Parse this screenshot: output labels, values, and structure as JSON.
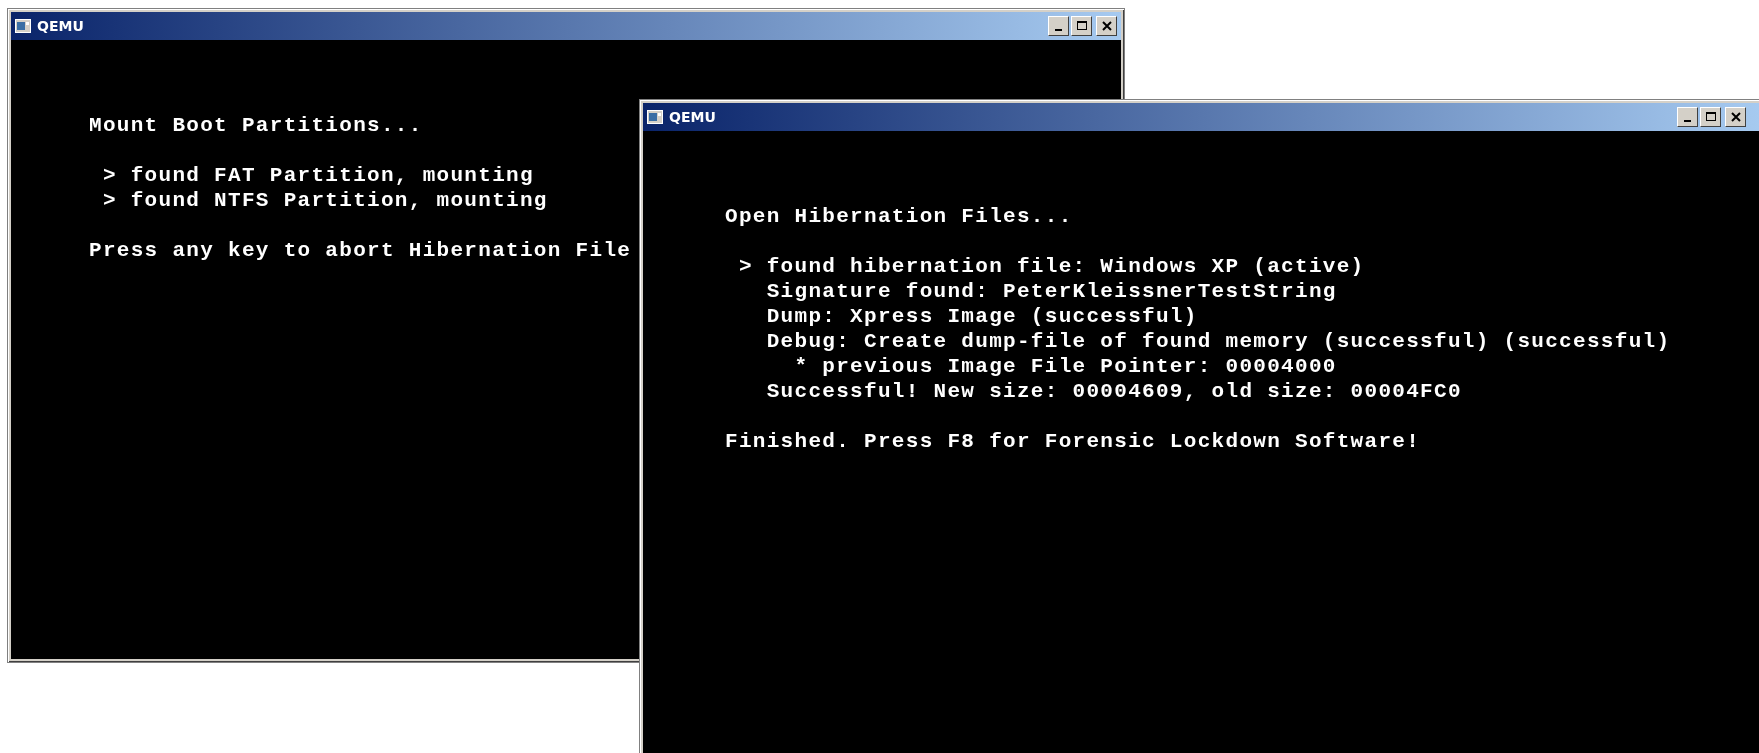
{
  "windows": [
    {
      "title": "QEMU",
      "console": [
        [
          "Mount Boot Partitions..."
        ],
        [
          " > found FAT Partition, mounting",
          " > found NTFS Partition, mounting"
        ],
        [
          "Press any key to abort Hibernation File"
        ]
      ]
    },
    {
      "title": "QEMU",
      "console": [
        [
          "Open Hibernation Files..."
        ],
        [
          " > found hibernation file: Windows XP (active)",
          "   Signature found: PeterKleissnerTestString",
          "   Dump: Xpress Image (successful)",
          "   Debug: Create dump-file of found memory (successful) (successful)",
          "     * previous Image File Pointer: 00004000",
          "   Successful! New size: 00004609, old size: 00004FC0"
        ],
        [
          "Finished. Press F8 for Forensic Lockdown Software!"
        ]
      ]
    }
  ]
}
